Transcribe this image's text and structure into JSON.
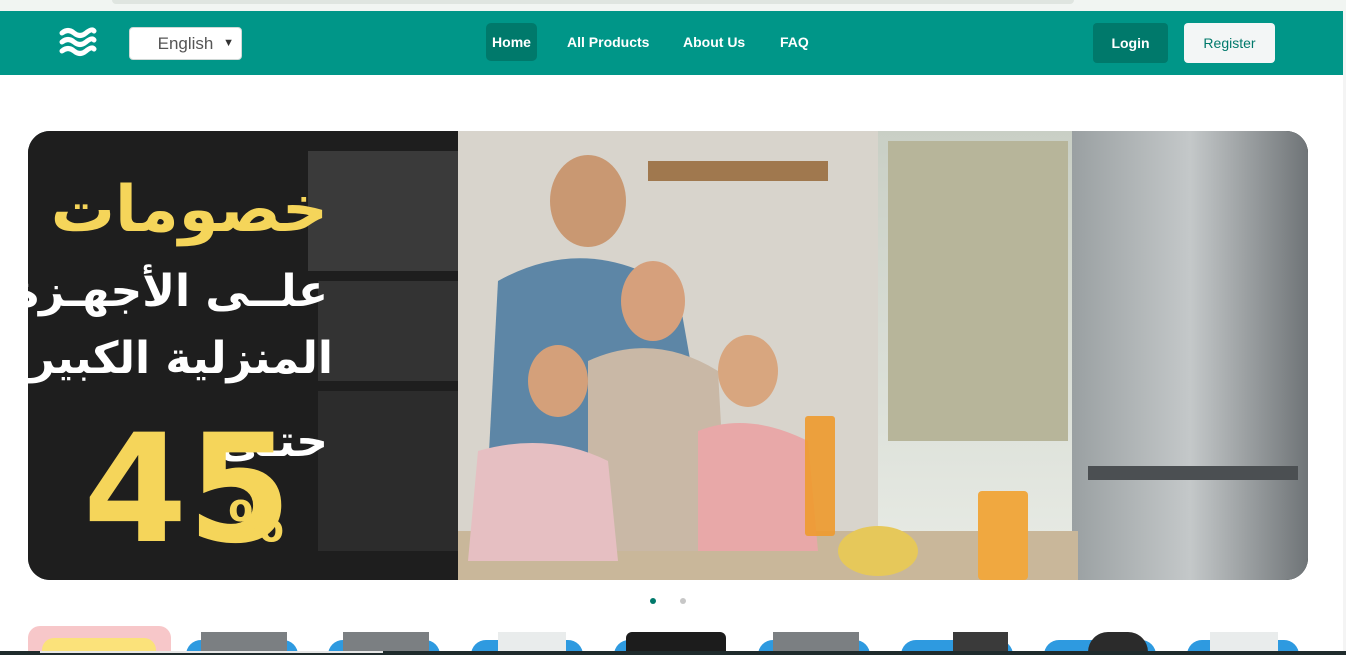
{
  "header": {
    "language_selected": "English",
    "nav": [
      "Home",
      "All Products",
      "About Us",
      "FAQ"
    ],
    "login_label": "Login",
    "register_label": "Register"
  },
  "banner": {
    "headline": "خصومات",
    "line2": "علــى الأجهـزة",
    "line3": "المنزلية الكبيرة",
    "upto": "حتـى",
    "percent": "45",
    "percent_sign": "%"
  },
  "carousel": {
    "slides": 2,
    "active_index": 0
  },
  "colors": {
    "primary": "#009688",
    "primary_dark": "#00796b",
    "accent_yellow": "#f5d55a"
  },
  "icons": {
    "logo": "waves-icon",
    "dropdown": "chevron-down-icon"
  }
}
